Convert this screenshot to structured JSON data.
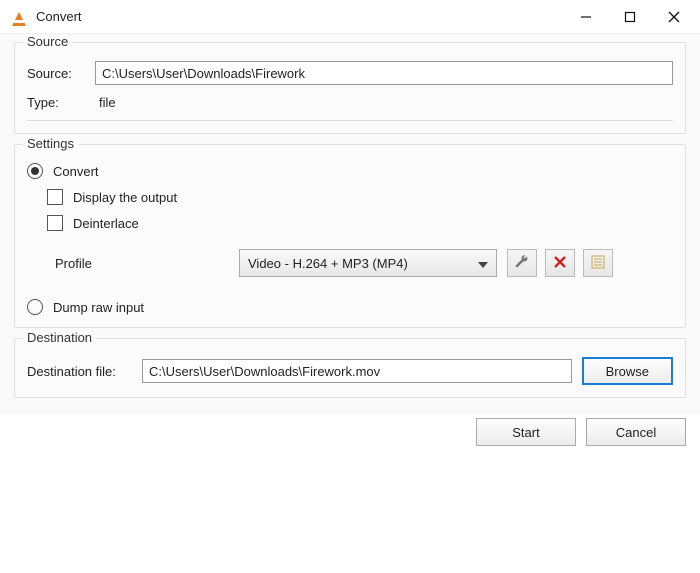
{
  "window": {
    "title": "Convert"
  },
  "source_group": {
    "legend": "Source",
    "source_label": "Source:",
    "source_value": "C:\\Users\\User\\Downloads\\Firework",
    "type_label": "Type:",
    "type_value": "file"
  },
  "settings_group": {
    "legend": "Settings",
    "convert_label": "Convert",
    "convert_checked": true,
    "display_output_label": "Display the output",
    "display_output_checked": false,
    "deinterlace_label": "Deinterlace",
    "deinterlace_checked": false,
    "profile_label": "Profile",
    "profile_selected": "Video - H.264 + MP3 (MP4)",
    "dump_raw_label": "Dump raw input",
    "dump_raw_checked": false
  },
  "destination_group": {
    "legend": "Destination",
    "dest_label": "Destination file:",
    "dest_value": "C:\\Users\\User\\Downloads\\Firework.mov",
    "browse_label": "Browse"
  },
  "footer": {
    "start_label": "Start",
    "cancel_label": "Cancel"
  }
}
